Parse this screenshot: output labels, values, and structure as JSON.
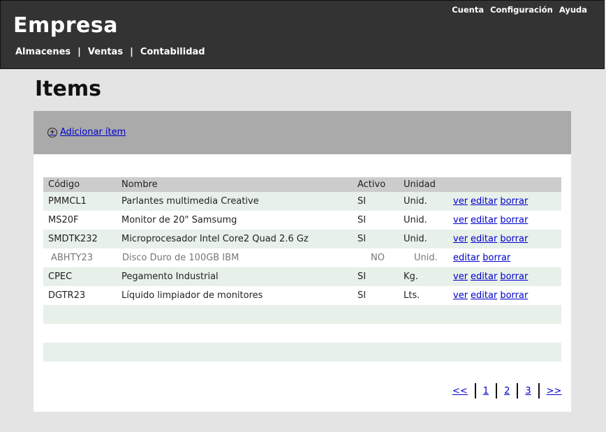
{
  "header": {
    "brand": "Empresa",
    "top_links": [
      "Cuenta",
      "Configuración",
      "Ayuda"
    ],
    "nav": [
      "Almacenes",
      "Ventas",
      "Contabilidad"
    ],
    "nav_separator": "|"
  },
  "page": {
    "title": "Items",
    "add_link": "Adicionar ítem"
  },
  "table": {
    "columns": [
      "Código",
      "Nombre",
      "Activo",
      "Unidad"
    ],
    "rows": [
      {
        "code": "PMMCL1",
        "name": "Parlantes multimedia Creative",
        "active": "SI",
        "unit": "Unid.",
        "actions": [
          "ver",
          "editar",
          "borrar"
        ]
      },
      {
        "code": "MS20F",
        "name": "Monitor de 20\" Samsumg",
        "active": "SI",
        "unit": "Unid.",
        "actions": [
          "ver",
          "editar",
          "borrar"
        ]
      },
      {
        "code": "SMDTK232",
        "name": "Microprocesador Intel Core2 Quad 2.6 Gz",
        "active": "SI",
        "unit": "Unid.",
        "actions": [
          "ver",
          "editar",
          "borrar"
        ]
      },
      {
        "code": "ABHTY23",
        "name": "Disco Duro de 100GB IBM",
        "active": "NO",
        "unit": "Unid.",
        "actions": [
          "editar",
          "borrar"
        ]
      },
      {
        "code": "CPEC",
        "name": "Pegamento Industrial",
        "active": "SI",
        "unit": "Kg.",
        "actions": [
          "ver",
          "editar",
          "borrar"
        ]
      },
      {
        "code": "DGTR23",
        "name": "Líquido limpiador de monitores",
        "active": "SI",
        "unit": "Lts.",
        "actions": [
          "ver",
          "editar",
          "borrar"
        ]
      }
    ],
    "empty_rows": 3
  },
  "pagination": {
    "first": "<<",
    "pages": [
      "1",
      "2",
      "3"
    ],
    "last": ">>"
  },
  "colors": {
    "header_bg": "#333333",
    "toolbar_bg": "#aaaaaa",
    "row_shade": "#e8f0ea",
    "link": "#0000cc"
  }
}
